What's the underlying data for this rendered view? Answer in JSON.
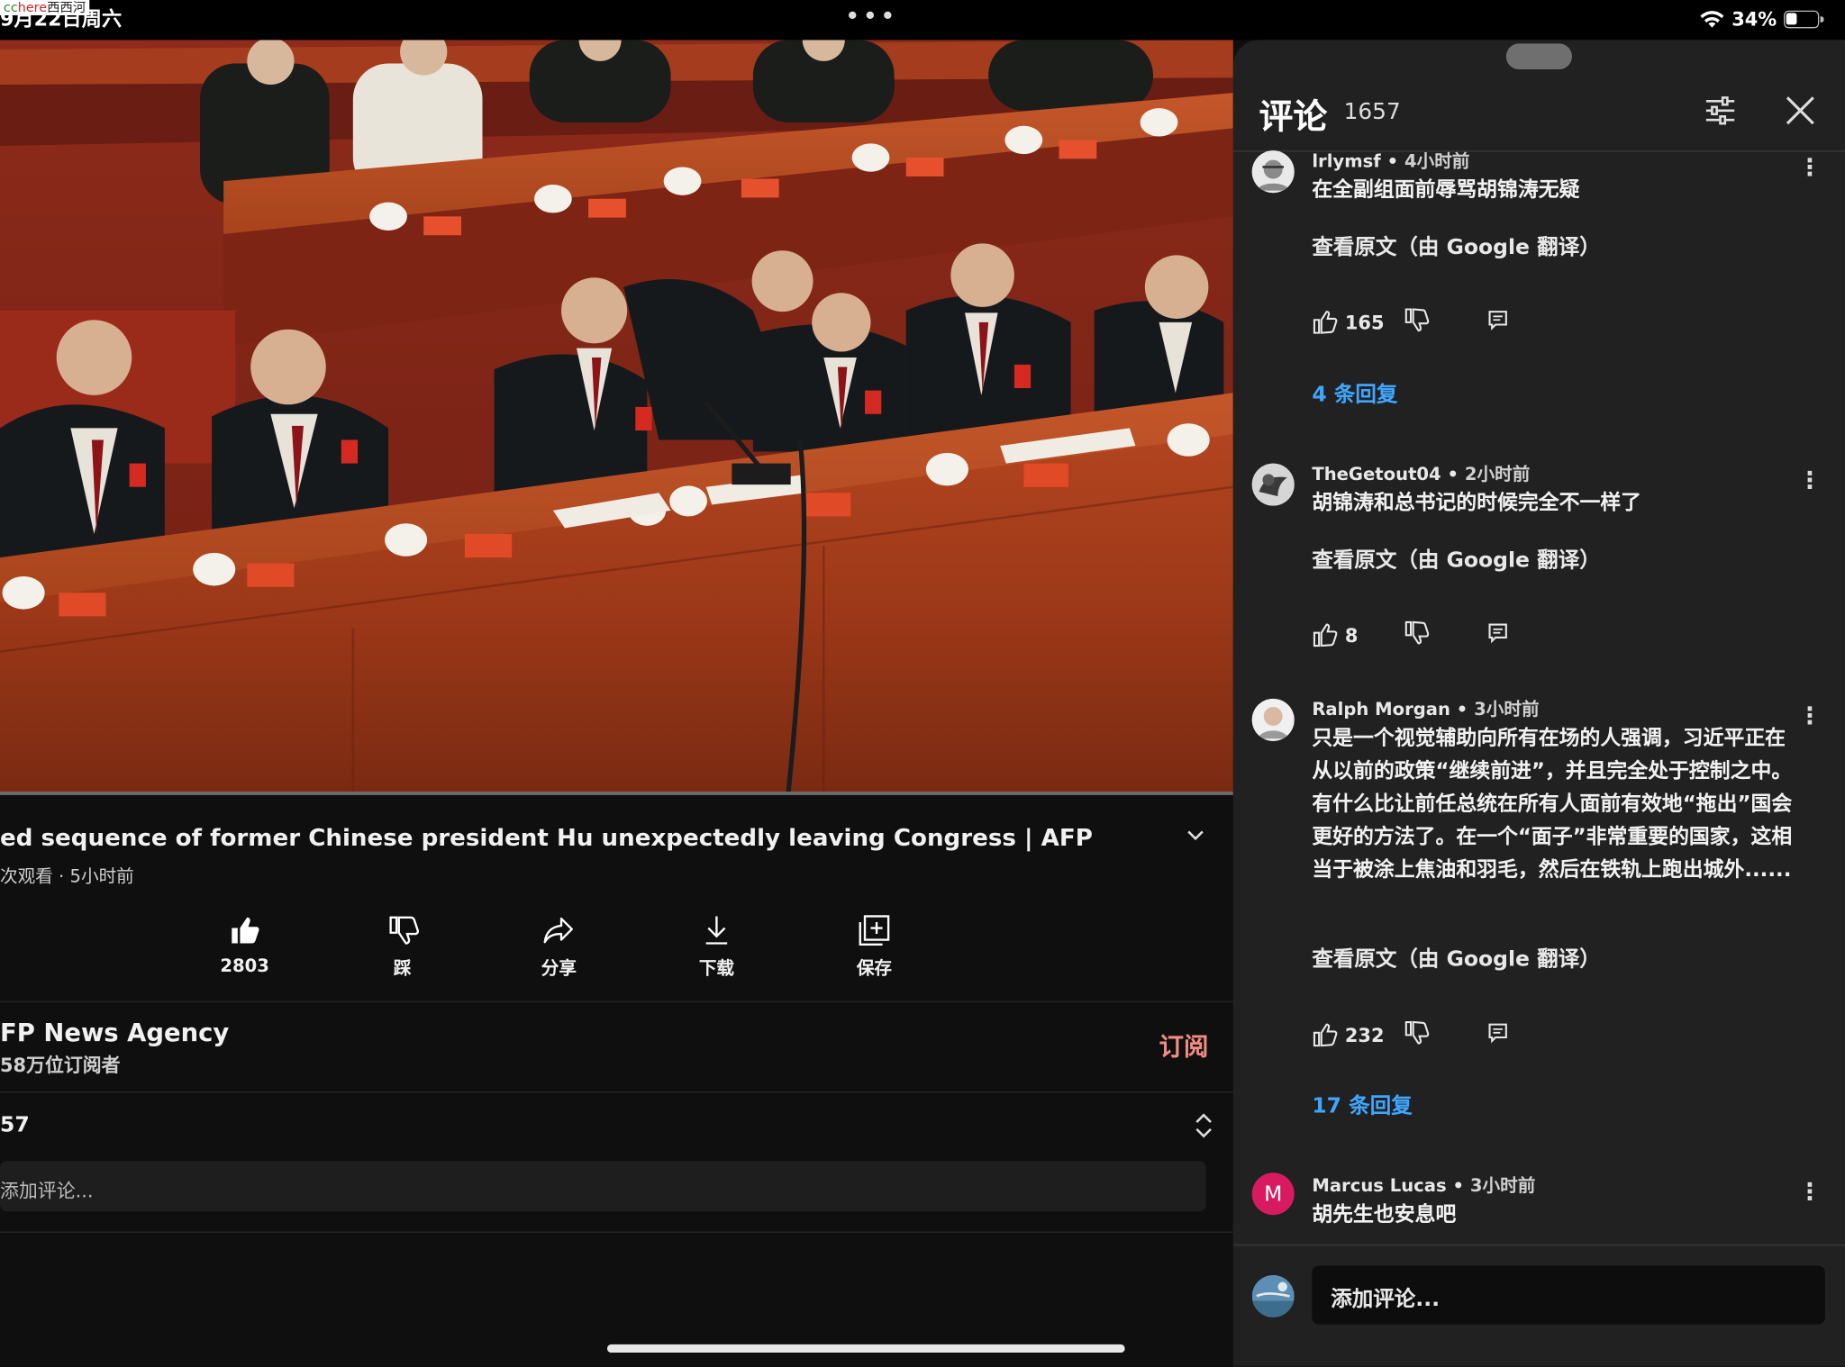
{
  "status_bar": {
    "time": "9月22日周六",
    "watermark": {
      "part1": "cc",
      "part2": "here",
      "part3": "西西河"
    },
    "dots": "•••",
    "battery": "34%",
    "battery_level": 0.34
  },
  "player": {
    "progress_fraction": 1.0
  },
  "video": {
    "title": "ed sequence of former Chinese president Hu unexpectedly leaving Congress | AFP",
    "views": "次观看",
    "age": "5小时前",
    "meta_sep": "·"
  },
  "actions": {
    "like": "2803",
    "dislike": "踩",
    "share": "分享",
    "download": "下载",
    "save": "保存"
  },
  "channel": {
    "name": "FP News Agency",
    "subscribers": "58万位订阅者",
    "subscribe": "订阅"
  },
  "comments_summary": {
    "count": "57",
    "add_placeholder": "添加评论..."
  },
  "panel": {
    "title": "评论",
    "count": "1657",
    "add_placeholder": "添加评论...",
    "comments": [
      {
        "author": "lrlymsf",
        "time": "4小时前",
        "text": "在全副组面前辱骂胡锦涛无疑",
        "translate": "查看原文（由 Google 翻译）",
        "likes": "165",
        "replies": "4 条回复"
      },
      {
        "author": "TheGetout04",
        "time": "2小时前",
        "text": "胡锦涛和总书记的时候完全不一样了",
        "translate": "查看原文（由 Google 翻译）",
        "likes": "8",
        "replies": ""
      },
      {
        "author": "Ralph Morgan",
        "time": "3小时前",
        "text": "只是一个视觉辅助向所有在场的人强调，习近平正在从以前的政策“继续前进”，并且完全处于控制之中。有什么比让前任总统在所有人面前有效地“拖出”国会更好的方法了。在一个“面子”非常重要的国家，这相当于被涂上焦油和羽毛，然后在铁轨上跑出城外......",
        "translate": "查看原文（由 Google 翻译）",
        "likes": "232",
        "replies": "17 条回复"
      },
      {
        "author": "Marcus Lucas",
        "time": "3小时前",
        "text": "胡先生也安息吧",
        "avatar_letter": "M"
      }
    ]
  },
  "colors": {
    "background": "#0f0f0f",
    "panel": "#212121",
    "link_blue": "#3ea6ff",
    "subscribe_red": "#f28b82",
    "avatar_m": "#d81b60"
  }
}
